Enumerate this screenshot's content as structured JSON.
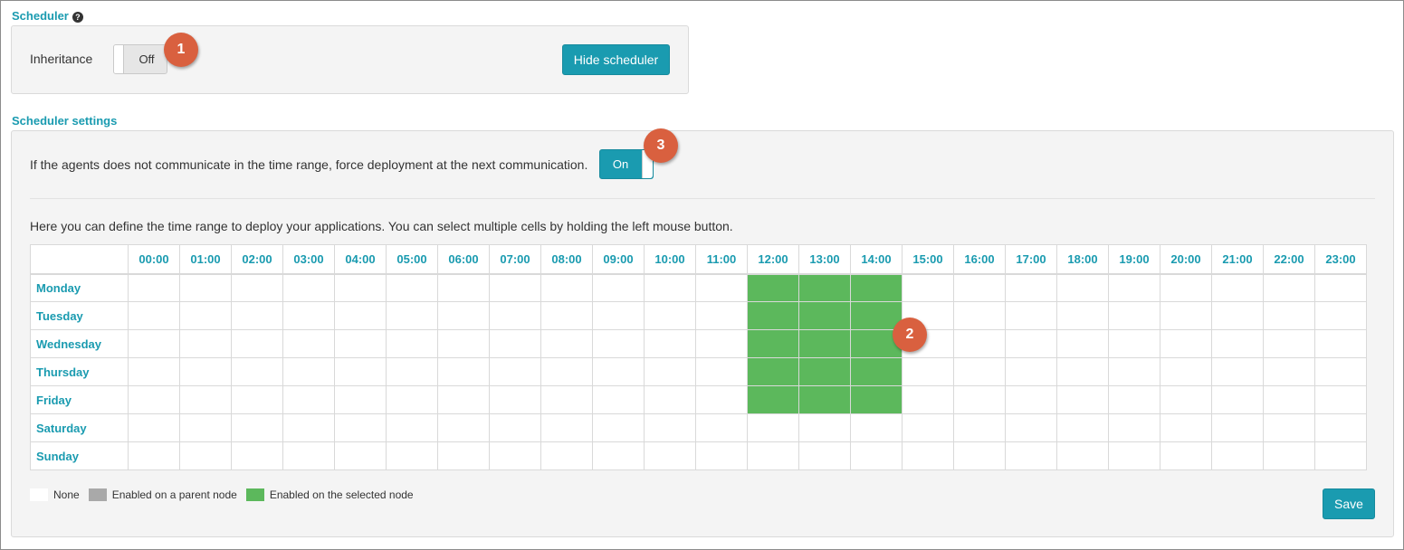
{
  "scheduler": {
    "title": "Scheduler",
    "help_icon": "question-circle-icon",
    "inheritance_label": "Inheritance",
    "inheritance_toggle": "Off",
    "hide_button": "Hide scheduler"
  },
  "settings": {
    "title": "Scheduler settings",
    "force_text": "If the agents does not communicate in the time range, force deployment at the next communication.",
    "force_toggle": "On",
    "description": "Here you can define the time range to deploy your applications. You can select multiple cells by holding the left mouse button.",
    "save_button": "Save"
  },
  "grid": {
    "hours": [
      "00:00",
      "01:00",
      "02:00",
      "03:00",
      "04:00",
      "05:00",
      "06:00",
      "07:00",
      "08:00",
      "09:00",
      "10:00",
      "11:00",
      "12:00",
      "13:00",
      "14:00",
      "15:00",
      "16:00",
      "17:00",
      "18:00",
      "19:00",
      "20:00",
      "21:00",
      "22:00",
      "23:00"
    ],
    "days": [
      "Monday",
      "Tuesday",
      "Wednesday",
      "Thursday",
      "Friday",
      "Saturday",
      "Sunday"
    ],
    "enabled": {
      "Monday": [
        "12:00",
        "13:00",
        "14:00"
      ],
      "Tuesday": [
        "12:00",
        "13:00",
        "14:00"
      ],
      "Wednesday": [
        "12:00",
        "13:00",
        "14:00"
      ],
      "Thursday": [
        "12:00",
        "13:00",
        "14:00"
      ],
      "Friday": [
        "12:00",
        "13:00",
        "14:00"
      ],
      "Saturday": [],
      "Sunday": []
    }
  },
  "legend": [
    {
      "label": "None",
      "color": "#ffffff"
    },
    {
      "label": "Enabled on a parent node",
      "color": "#a9a9a9"
    },
    {
      "label": "Enabled on the selected node",
      "color": "#5cb85c"
    }
  ],
  "badges": [
    "1",
    "2",
    "3"
  ],
  "colors": {
    "accent": "#1a9bb0",
    "enabled": "#5cb85c",
    "badge": "#d9603f"
  }
}
